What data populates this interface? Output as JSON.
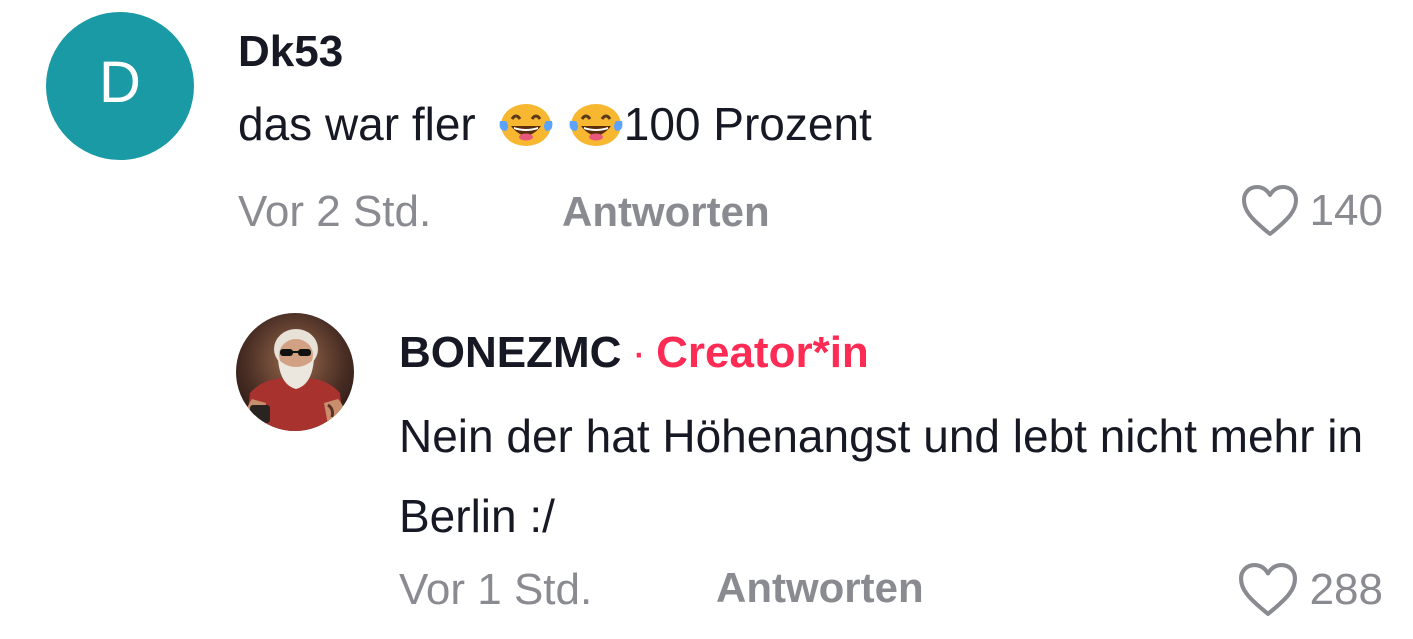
{
  "comment": {
    "avatar_letter": "D",
    "avatar_color": "#1a9aa5",
    "username": "Dk53",
    "text_before": "das war fler",
    "emoji_1": "face-with-tears-of-joy",
    "emoji_2": "face-with-tears-of-joy",
    "text_after": "100 Prozent",
    "time": "Vor 2 Std.",
    "reply_label": "Antworten",
    "like_count": "140",
    "like_icon": "heart-outline-icon"
  },
  "reply": {
    "avatar": "profile-photo-bearded-man-sunglasses",
    "username": "BONEZMC",
    "separator": "·",
    "badge": "Creator*in",
    "badge_color": "#fe2c55",
    "text": "Nein der hat Höhenangst und lebt nicht mehr in Berlin :/",
    "time": "Vor 1 Std.",
    "reply_label": "Antworten",
    "like_count": "288",
    "like_icon": "heart-outline-icon"
  }
}
